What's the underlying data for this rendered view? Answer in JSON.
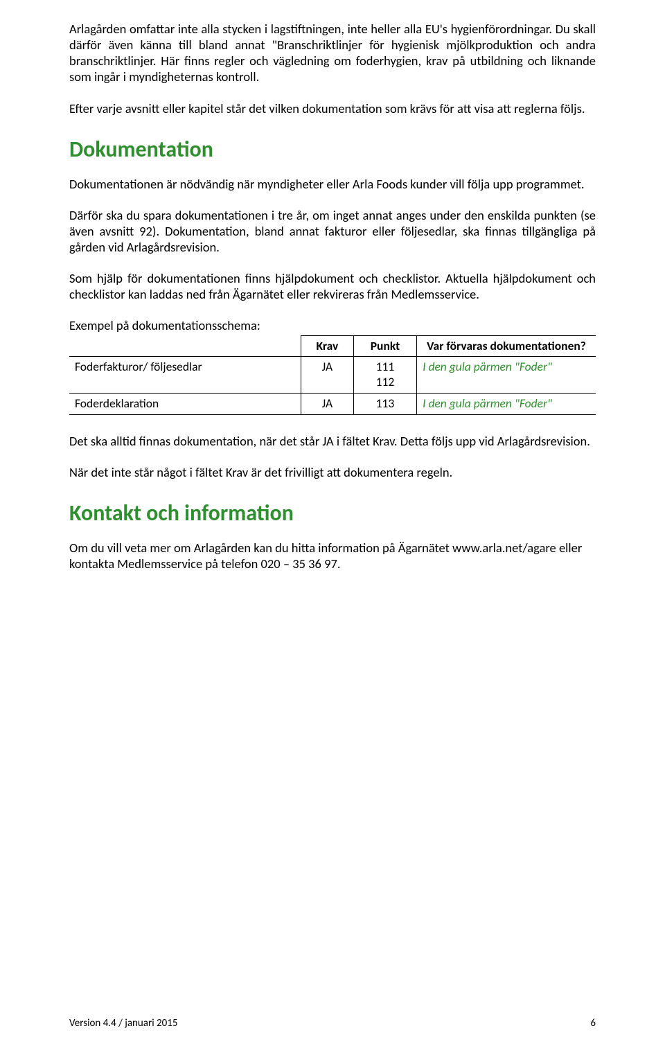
{
  "paragraphs": {
    "intro1": "Arlagården omfattar inte alla stycken i lagstiftningen, inte heller alla EU's hygienförordningar. Du skall därför även känna till bland annat \"Branschriktlinjer för hygienisk mjölkproduktion och andra branschriktlinjer. Här finns regler och vägledning om foderhygien, krav på utbildning och liknande som ingår i myndigheternas kontroll.",
    "intro2": "Efter varje avsnitt eller kapitel står det vilken dokumentation som krävs för att visa att reglerna följs.",
    "dok1": "Dokumentationen är nödvändig när myndigheter eller Arla Foods kunder vill följa upp programmet.",
    "dok2": "Därför ska du spara dokumentationen i tre år, om inget annat anges under den enskilda punkten (se även avsnitt 92). Dokumentation, bland annat fakturor eller följesedlar, ska finnas tillgängliga på gården vid Arlagårdsrevision.",
    "dok3": "Som hjälp för dokumentationen finns hjälpdokument och checklistor. Aktuella hjälpdokument och checklistor kan laddas ned från Ägarnätet eller rekvireras från Medlemsservice.",
    "schema_label": "Exempel på dokumentationsschema:",
    "after1": "Det ska alltid finnas dokumentation, när det står JA i fältet Krav. Detta följs upp vid Arlagårdsrevision.",
    "after2": "När det inte står något i fältet Krav är det frivilligt att dokumentera regeln.",
    "kontakt": "Om du vill veta mer om Arlagården kan du hitta information på Ägarnätet www.arla.net/agare eller kontakta Medlemsservice på telefon 020 – 35 36 97."
  },
  "headings": {
    "dokumentation": "Dokumentation",
    "kontakt": "Kontakt och information"
  },
  "table": {
    "headers": {
      "desc": "",
      "krav": "Krav",
      "punkt": "Punkt",
      "var": "Var förvaras dokumentationen?"
    },
    "rows": [
      {
        "desc": "Foderfakturor/ följesedlar",
        "krav": "JA",
        "punkt": "111\n112",
        "var": "I den gula pärmen \"Foder\""
      },
      {
        "desc": "Foderdeklaration",
        "krav": "JA",
        "punkt": "113",
        "var": "I den gula pärmen \"Foder\""
      }
    ]
  },
  "footer": {
    "version": "Version 4.4 / januari 2015",
    "page": "6"
  }
}
